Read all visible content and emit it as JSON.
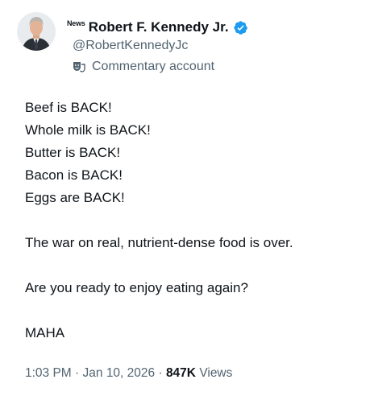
{
  "author": {
    "news_tag": "News",
    "display_name": "Robert F. Kennedy Jr.",
    "handle": "@RobertKennedyJc",
    "account_label": "Commentary account",
    "verified_color": "#1d9bf0"
  },
  "tweet": {
    "lines": [
      "Beef is BACK!",
      "Whole milk is BACK!",
      "Butter is BACK!",
      "Bacon is BACK!",
      "Eggs are BACK!",
      "",
      "The war on real, nutrient-dense food is over.",
      "",
      "Are you ready to enjoy eating again?",
      "",
      "MAHA"
    ],
    "time": "1:03 PM",
    "separator": " · ",
    "date": "Jan 10, 2026",
    "views_count": "847K",
    "views_label": "Views"
  },
  "icons": {
    "verified": "verified-badge-icon",
    "label": "comedy-mask-icon"
  },
  "colors": {
    "text_primary": "#0f1419",
    "text_secondary": "#536471"
  }
}
